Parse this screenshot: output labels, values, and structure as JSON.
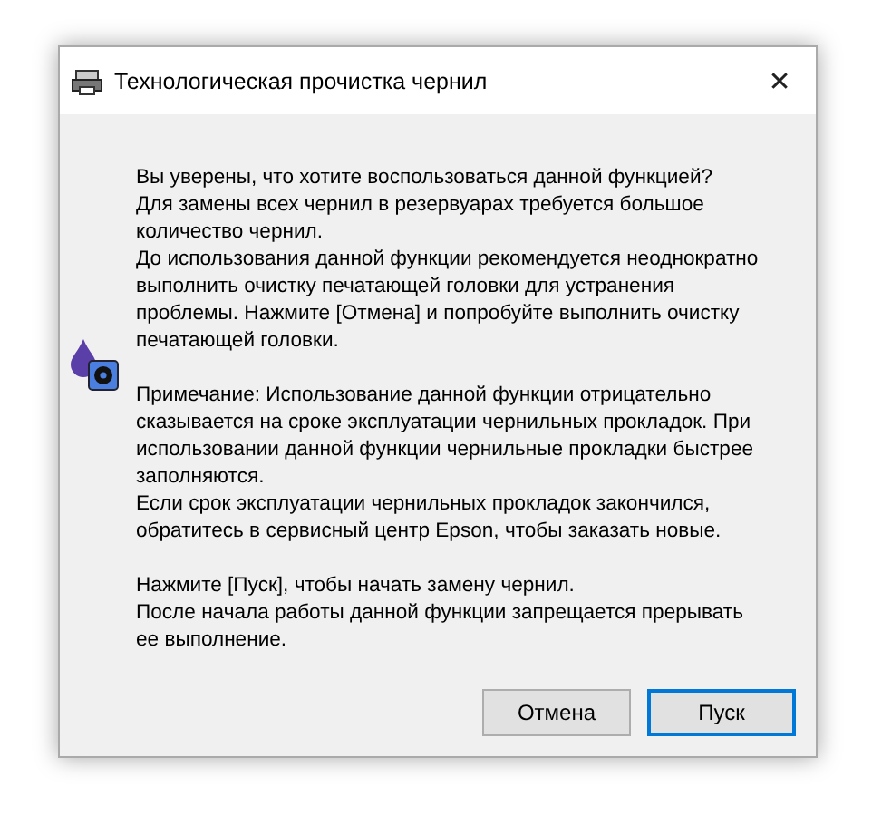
{
  "window": {
    "title": "Технологическая прочистка чернил",
    "close": "✕"
  },
  "blocks": [
    [
      "Вы уверены, что хотите воспользоваться данной функцией?",
      "Для замены всех чернил в резервуарах требуется большое",
      "количество чернил.",
      "До использования данной функции рекомендуется неоднократно",
      "выполнить очистку печатающей головки для устранения",
      "проблемы. Нажмите [Отмена] и попробуйте выполнить очистку",
      "печатающей головки."
    ],
    [
      "Примечание: Использование данной функции отрицательно",
      "сказывается на сроке эксплуатации чернильных прокладок. При",
      "использовании данной функции чернильные прокладки быстрее",
      "заполняются.",
      "Если срок эксплуатации чернильных прокладок закончился,",
      "обратитесь в сервисный центр Epson, чтобы заказать новые."
    ],
    [
      "Нажмите [Пуск], чтобы начать замену чернил.",
      "После начала работы данной функции запрещается прерывать",
      "ее выполнение."
    ]
  ],
  "buttons": [
    {
      "label": "Отмена",
      "selected": false
    },
    {
      "label": "Пуск",
      "selected": true
    }
  ]
}
